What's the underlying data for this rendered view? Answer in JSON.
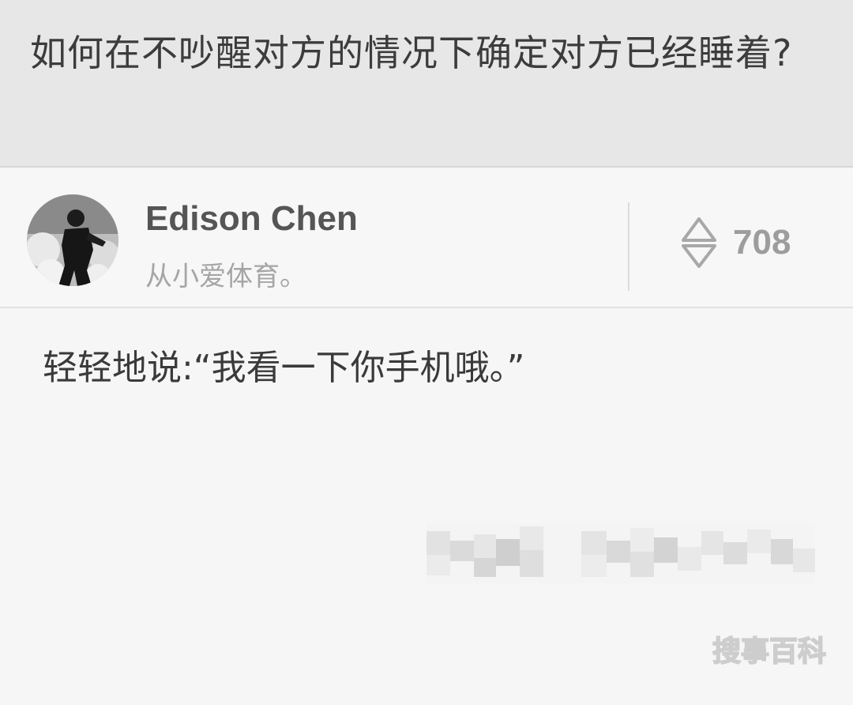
{
  "question": {
    "title": "如何在不吵醒对方的情况下确定对方已经睡着?"
  },
  "author": {
    "name": "Edison Chen",
    "bio": "从小爱体育。",
    "avatar_icon": "person-photo-avatar"
  },
  "vote": {
    "count": "708",
    "icon": "up-down-vote-icon"
  },
  "answer": {
    "text": "轻轻地说:“我看一下你手机哦。”"
  },
  "watermark": {
    "text": "搜事百科"
  },
  "colors": {
    "header_bg": "#e7e7e7",
    "body_bg": "#f6f6f6",
    "name_color": "#555555",
    "bio_color": "#a5a5a5",
    "vote_color": "#9d9d9d"
  }
}
